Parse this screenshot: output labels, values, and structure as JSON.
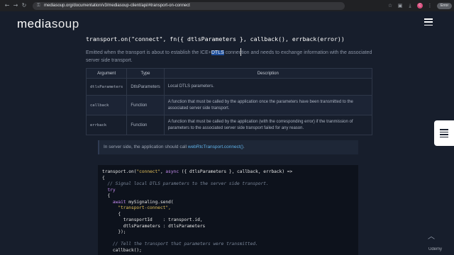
{
  "browser": {
    "url": "mediasoup.org/documentation/v3/mediasoup-client/api/#transport-on-connect",
    "profile_initial": "C",
    "error_label": "Error"
  },
  "site": {
    "logo_media": "media",
    "logo_soup": "soup"
  },
  "section": {
    "heading": "transport.on(\"connect\", fn({ dtlsParameters }, callback(), errback(error))",
    "desc_before": "Emitted when the transport is about to establish the ICE+",
    "desc_highlight": "DTLS",
    "desc_after": " connection and needs to exchange information with the associated server side transport."
  },
  "table": {
    "headers": [
      "Argument",
      "Type",
      "Description"
    ],
    "rows": [
      {
        "argument": "dtlsParameters",
        "type": "DtlsParameters",
        "type_is_link": true,
        "description": "Local DTLS parameters."
      },
      {
        "argument": "callback",
        "type": "Function",
        "type_is_link": false,
        "description": "A function that must be called by the application once the parameters have been transmitted to the associated server side transport."
      },
      {
        "argument": "errback",
        "type": "Function",
        "type_is_link": false,
        "description": "A function that must be called by the application (with the corresponding error) if the tranmission of parameters to the associated server side transport failed for any reason."
      }
    ]
  },
  "note": {
    "text_before": "In server side, the application should call ",
    "link": "webRtcTransport.connect()",
    "text_after": "."
  },
  "code": {
    "l1_a": "transport.on(",
    "l1_s": "\"connect\"",
    "l1_b": ", ",
    "l1_k": "async",
    "l1_c": " ({ dtlsParameters }, callback, errback) =>",
    "l2": "{",
    "l3": "  // Signal local DTLS parameters to the server side transport.",
    "l4": "  try",
    "l5": "  {",
    "l6_k": "    await",
    "l6_b": " mySignaling.send(",
    "l7": "      \"transport-connect\",",
    "l8": "      {",
    "l9": "        transportId    : transport.id,",
    "l10": "        dtlsParameters : dtlsParameters",
    "l11": "      });",
    "l12": "",
    "l13": "    // Tell the transport that parameters were transmitted.",
    "l14": "    callback();"
  },
  "watermark": "Udemy",
  "colors": {
    "background": "#171e2c",
    "link": "#5fb0e6",
    "highlight": "#1e4f9c"
  },
  "icons": [
    "back-icon",
    "forward-icon",
    "reload-icon",
    "lock-icon",
    "menu-icon",
    "toc-icon",
    "scroll-top-icon"
  ]
}
